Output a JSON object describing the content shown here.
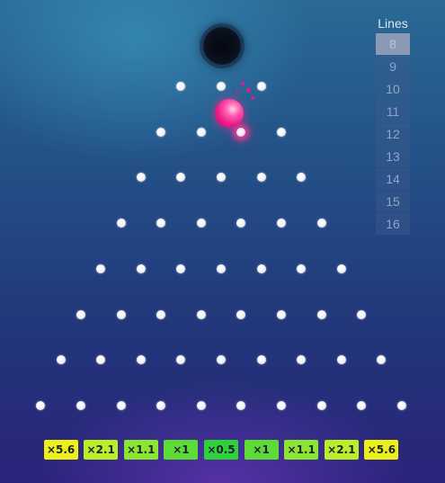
{
  "lines_panel": {
    "title": "Lines",
    "options": [
      "8",
      "9",
      "10",
      "11",
      "12",
      "13",
      "14",
      "15",
      "16"
    ],
    "selected": "8"
  },
  "board": {
    "rows": 8,
    "hit_peg": {
      "row": 1,
      "index": 2
    }
  },
  "multipliers": [
    {
      "label": "×5.6",
      "color": "#ecef1a"
    },
    {
      "label": "×2.1",
      "color": "#b9ee28"
    },
    {
      "label": "×1.1",
      "color": "#8be632"
    },
    {
      "label": "×1",
      "color": "#5ddc38"
    },
    {
      "label": "×0.5",
      "color": "#2ed13a"
    },
    {
      "label": "×1",
      "color": "#5ddc38"
    },
    {
      "label": "×1.1",
      "color": "#8be632"
    },
    {
      "label": "×2.1",
      "color": "#b9ee28"
    },
    {
      "label": "×5.6",
      "color": "#ecef1a"
    }
  ]
}
